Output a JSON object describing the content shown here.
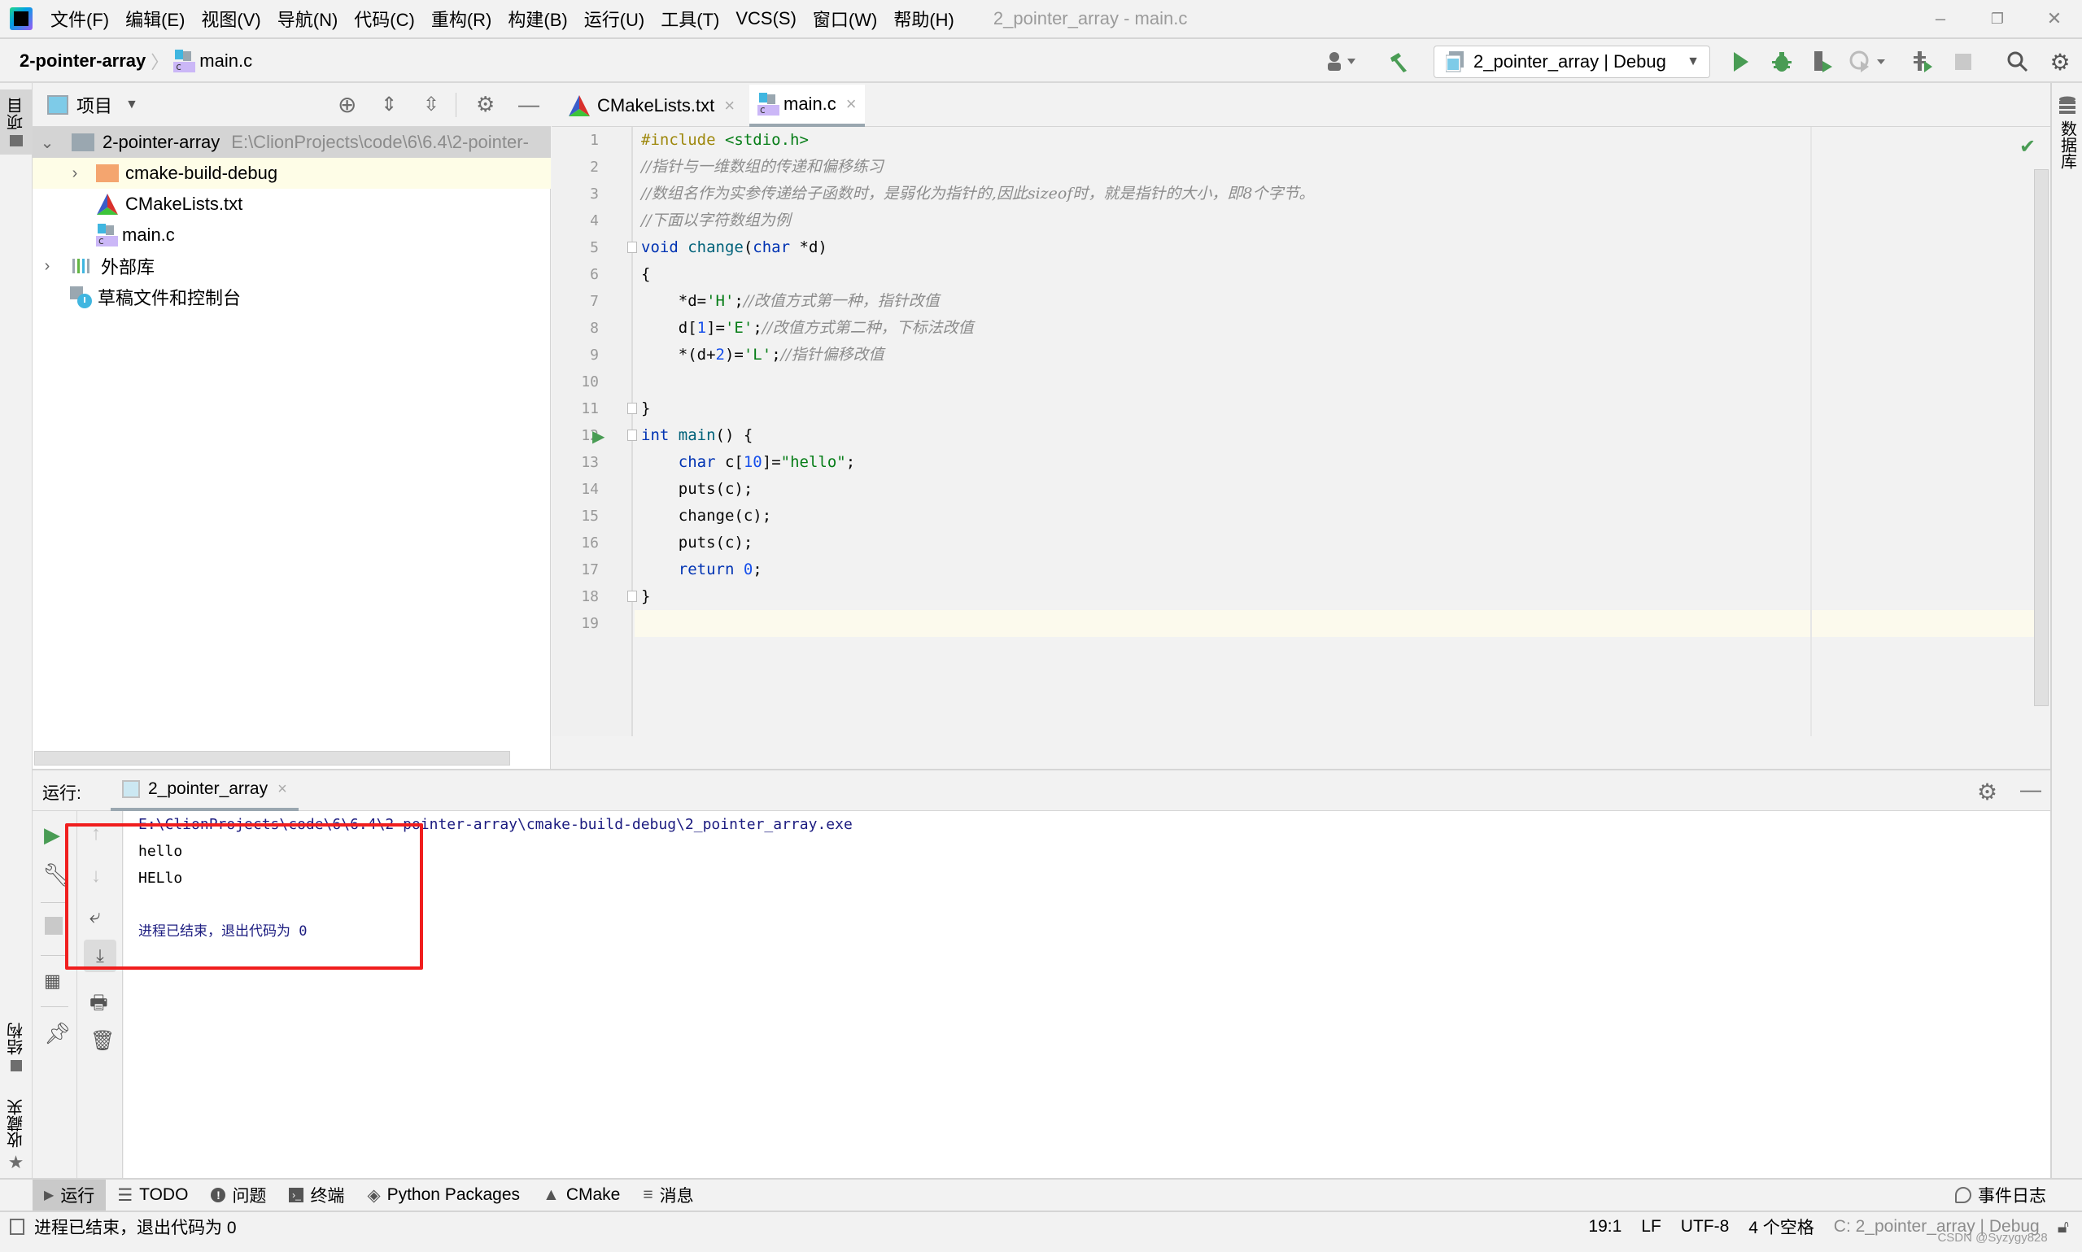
{
  "menubar": {
    "items": [
      "文件(F)",
      "编辑(E)",
      "视图(V)",
      "导航(N)",
      "代码(C)",
      "重构(R)",
      "构建(B)",
      "运行(U)",
      "工具(T)",
      "VCS(S)",
      "窗口(W)",
      "帮助(H)"
    ],
    "window_title": "2_pointer_array - main.c",
    "minimize": "–",
    "restore": "❐",
    "close": "✕"
  },
  "navbar": {
    "project": "2-pointer-array",
    "separator": "〉",
    "file": "main.c",
    "run_config": "2_pointer_array | Debug"
  },
  "left_stripe": {
    "project_tab": "项目",
    "structure_tab": "结构",
    "favorites_tab": "收藏夹"
  },
  "right_stripe": {
    "database_tab": "数据库"
  },
  "project_panel": {
    "title": "项目",
    "tree": [
      {
        "label": "2-pointer-array",
        "path": "E:\\ClionProjects\\code\\6\\6.4\\2-pointer-",
        "icon": "folder-icon",
        "expanded": true
      },
      {
        "label": "cmake-build-debug",
        "icon": "folder-orange-icon",
        "expanded": false
      },
      {
        "label": "CMakeLists.txt",
        "icon": "cmake-icon"
      },
      {
        "label": "main.c",
        "icon": "c-file-icon"
      },
      {
        "label": "外部库",
        "icon": "library-icon",
        "expanded": false
      },
      {
        "label": "草稿文件和控制台",
        "icon": "scratch-icon"
      }
    ]
  },
  "editor": {
    "tabs": [
      {
        "label": "CMakeLists.txt",
        "active": false
      },
      {
        "label": "main.c",
        "active": true
      }
    ],
    "line_numbers": [
      "1",
      "2",
      "3",
      "4",
      "5",
      "6",
      "7",
      "8",
      "9",
      "10",
      "11",
      "12",
      "13",
      "14",
      "15",
      "16",
      "17",
      "18",
      "19"
    ],
    "lines": [
      [
        {
          "t": "#include ",
          "c": "pp"
        },
        {
          "t": "<stdio.h>",
          "c": "str"
        }
      ],
      [
        {
          "t": "//指针与一维数组的传递和偏移练习",
          "c": "cm"
        }
      ],
      [
        {
          "t": "//数组名作为实参传递给子函数时，是弱化为指针的,因此sizeof时，就是指针的大小，即8个字节。",
          "c": "cm"
        }
      ],
      [
        {
          "t": "//下面以字符数组为例",
          "c": "cm"
        }
      ],
      [
        {
          "t": "void ",
          "c": "kw"
        },
        {
          "t": "change",
          "c": "fn"
        },
        {
          "t": "(",
          "c": ""
        },
        {
          "t": "char ",
          "c": "kw"
        },
        {
          "t": "*d)",
          "c": ""
        }
      ],
      [
        {
          "t": "{",
          "c": ""
        }
      ],
      [
        {
          "t": "    *d=",
          "c": ""
        },
        {
          "t": "'H'",
          "c": "str"
        },
        {
          "t": ";",
          "c": ""
        },
        {
          "t": "//改值方式第一种，指针改值",
          "c": "cm"
        }
      ],
      [
        {
          "t": "    d[",
          "c": ""
        },
        {
          "t": "1",
          "c": "num"
        },
        {
          "t": "]=",
          "c": ""
        },
        {
          "t": "'E'",
          "c": "str"
        },
        {
          "t": ";",
          "c": ""
        },
        {
          "t": "//改值方式第二种，下标法改值",
          "c": "cm"
        }
      ],
      [
        {
          "t": "    *(d+",
          "c": ""
        },
        {
          "t": "2",
          "c": "num"
        },
        {
          "t": ")=",
          "c": ""
        },
        {
          "t": "'L'",
          "c": "str"
        },
        {
          "t": ";",
          "c": ""
        },
        {
          "t": "//指针偏移改值",
          "c": "cm"
        }
      ],
      [],
      [
        {
          "t": "}",
          "c": ""
        }
      ],
      [
        {
          "t": "int ",
          "c": "kw"
        },
        {
          "t": "main",
          "c": "fn"
        },
        {
          "t": "() {",
          "c": ""
        }
      ],
      [
        {
          "t": "    ",
          "c": ""
        },
        {
          "t": "char ",
          "c": "kw"
        },
        {
          "t": "c[",
          "c": ""
        },
        {
          "t": "10",
          "c": "num"
        },
        {
          "t": "]=",
          "c": ""
        },
        {
          "t": "\"hello\"",
          "c": "str"
        },
        {
          "t": ";",
          "c": ""
        }
      ],
      [
        {
          "t": "    puts(c);",
          "c": ""
        }
      ],
      [
        {
          "t": "    change(c);",
          "c": ""
        }
      ],
      [
        {
          "t": "    puts(c);",
          "c": ""
        }
      ],
      [
        {
          "t": "    ",
          "c": ""
        },
        {
          "t": "return ",
          "c": "kw"
        },
        {
          "t": "0",
          "c": "num"
        },
        {
          "t": ";",
          "c": ""
        }
      ],
      [
        {
          "t": "}",
          "c": ""
        }
      ],
      []
    ],
    "inspection_status": "ok"
  },
  "run_panel": {
    "label": "运行:",
    "tab": "2_pointer_array",
    "output": [
      {
        "text": "E:\\ClionProjects\\code\\6\\6.4\\2-pointer-array\\cmake-build-debug\\2_pointer_array.exe",
        "kind": "path"
      },
      {
        "text": "hello",
        "kind": "stdout"
      },
      {
        "text": "HELlo",
        "kind": "stdout"
      },
      {
        "text": "",
        "kind": "blank"
      },
      {
        "text": "进程已结束，退出代码为 0",
        "kind": "system"
      }
    ]
  },
  "toolwindows": [
    {
      "label": "运行",
      "icon": "run-icon",
      "active": true
    },
    {
      "label": "TODO",
      "icon": "list-icon"
    },
    {
      "label": "问题",
      "icon": "problems-icon"
    },
    {
      "label": "终端",
      "icon": "terminal-icon"
    },
    {
      "label": "Python Packages",
      "icon": "packages-icon"
    },
    {
      "label": "CMake",
      "icon": "cmake-icon"
    },
    {
      "label": "消息",
      "icon": "messages-icon"
    }
  ],
  "event_log": "事件日志",
  "statusbar": {
    "message": "进程已结束，退出代码为 0",
    "position": "19:1",
    "line_sep": "LF",
    "encoding": "UTF-8",
    "indent": "4 个空格",
    "context": "C: 2_pointer_array | Debug",
    "watermark": "CSDN @Syzygy828"
  },
  "colors": {
    "highlight_box": "#f01e1e",
    "run_green": "#499c54",
    "keyword": "#0033b3",
    "string": "#067d17",
    "number": "#1750eb",
    "comment": "#8c8c8c"
  }
}
